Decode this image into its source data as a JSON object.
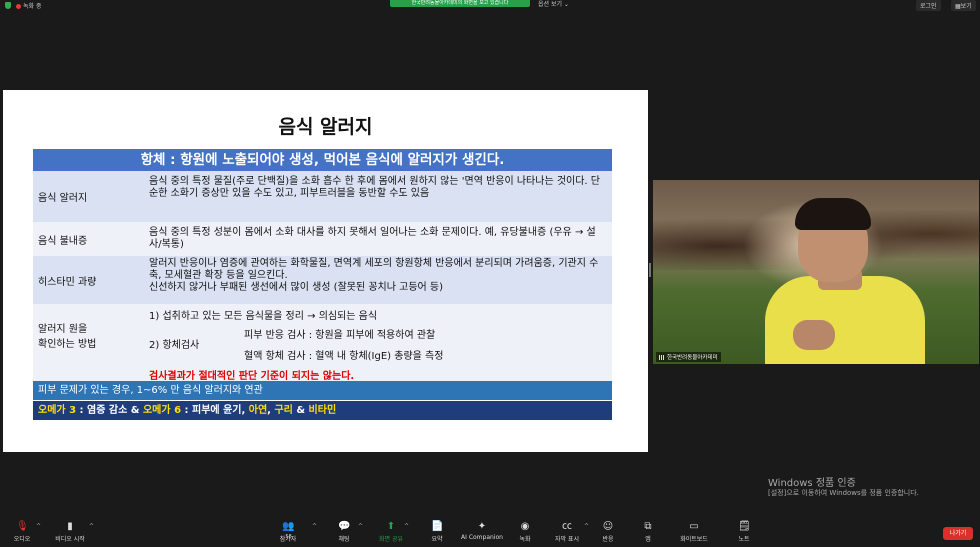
{
  "topbar": {
    "recording_label": "녹화 중",
    "banner_text": "한국반려동물아카데미의 화면을 보고 있습니다",
    "view_options": "옵션 보기",
    "login_button": "로그인",
    "view_button": "보기"
  },
  "slide": {
    "title": "음식 알러지",
    "header_band": "항체 : 항원에 노출되어야 생성, 먹어본 음식에 알러지가 생긴다.",
    "rows": [
      {
        "label": "음식 알러지",
        "desc": "음식 중의 특정 물질(주로 단백질)을 소화 흡수 한 후에 몸에서 원하지 않는 '면역 반응이 나타나는 것이다. 단순한 소화기 증상만 있을 수도 있고, 피부트러블을 동반할 수도 있음"
      },
      {
        "label": "음식 불내증",
        "desc": "음식 중의 특정 성분이 몸에서 소화 대사를 하지 못해서 일어나는 소화 문제이다. 예, 유당불내증 (우유 → 설사/복통)"
      },
      {
        "label": "히스타민 과량",
        "desc_line1": "알러지 반응이나 염증에 관여하는 화학물질, 면역계 세포의 항원항체 반응에서 분리되며 가려움증, 기관지 수축, 모세혈관 확장 등을 일으킨다.",
        "desc_line2": "신선하지 않거나 부패된 생선에서 많이 생성 (잘못된 꽁치나 고등어 등)"
      }
    ],
    "method": {
      "label_line1": "알러지 원을",
      "label_line2": "확인하는 방법",
      "step1": "1) 섭취하고 있는 모든 음식물을 정리 → 의심되는 음식",
      "step2": "2) 항체검사",
      "test1": "피부 반응 검사 : 항원을 피부에 적용하여 관찰",
      "test2": "혈액 항체 검사 : 혈액 내 항체(IgE) 총량을 측정",
      "warning": "검사결과가 절대적인 판단 기준이 되지는 않는다."
    },
    "band2": "피부 문제가 있는 경우, 1~6% 만 음식 알러지와 연관",
    "band3": {
      "part1": "오메가 3",
      "part2": ": 염증 감소 & ",
      "part3": "오메가 6",
      "part4": ": 피부에 윤기, ",
      "part5": "아연",
      "part6": ", ",
      "part7": "구리",
      "part8": " & ",
      "part9": "비타민"
    }
  },
  "video": {
    "participant_name": "한국반려동물아카데미"
  },
  "watermark": {
    "line1": "Windows 정품 인증",
    "line2": "[설정]으로 이동하여 Windows를 정품 인증합니다."
  },
  "toolbar": {
    "audio": "오디오",
    "video": "비디오 시작",
    "participants": "참가자",
    "participants_count": "58",
    "chat": "채팅",
    "share": "화면 공유",
    "summary": "요약",
    "ai": "AI Companion",
    "record": "녹화",
    "captions": "자막 표시",
    "reactions": "반응",
    "apps": "앱",
    "whiteboard": "화이트보드",
    "notes": "노트",
    "leave": "나가기"
  },
  "colors": {
    "header_band": "#4472c4",
    "band2": "#2e75b6",
    "band3": "#1f3d7a",
    "highlight_yellow": "#ffe000",
    "warning_red": "#e00000",
    "leave_red": "#d9302b",
    "share_green": "#27a04a"
  }
}
